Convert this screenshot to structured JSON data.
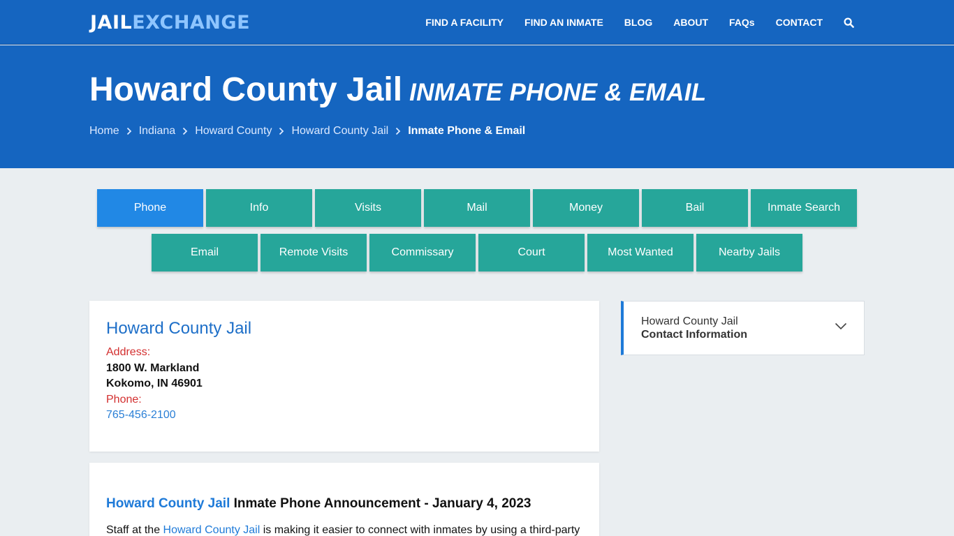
{
  "nav": {
    "logo_part1": "JAIL",
    "logo_part2": "EXCHANGE",
    "links": [
      "FIND A FACILITY",
      "FIND AN INMATE",
      "BLOG",
      "ABOUT",
      "FAQs",
      "CONTACT"
    ],
    "search_icon": "search-icon"
  },
  "hero": {
    "title": "Howard County Jail",
    "subtitle": "INMATE PHONE & EMAIL",
    "breadcrumbs": [
      "Home",
      "Indiana",
      "Howard County",
      "Howard County Jail",
      "Inmate Phone & Email"
    ]
  },
  "tabs": {
    "row1": [
      "Phone",
      "Info",
      "Visits",
      "Mail",
      "Money",
      "Bail",
      "Inmate Search"
    ],
    "row2": [
      "Email",
      "Remote Visits",
      "Commissary",
      "Court",
      "Most Wanted",
      "Nearby Jails"
    ],
    "active": "Phone"
  },
  "facility": {
    "name": "Howard County Jail",
    "address_label": "Address:",
    "address_line1": "1800 W. Markland",
    "address_line2": "Kokomo, IN 46901",
    "phone_label": "Phone:",
    "phone": "765-456-2100"
  },
  "announcement": {
    "title_link": "Howard County Jail",
    "title_rest": " Inmate Phone Announcement - January 4, 2023",
    "body_prefix": "Staff at the ",
    "body_link": "Howard County Jail",
    "body_suffix": " is making it easier to connect with inmates by using a third-party"
  },
  "sidebar": {
    "line1": "Howard County Jail",
    "line2": "Contact Information"
  },
  "colors": {
    "nav_blue": "#1565c0",
    "tab_teal": "#26a69a",
    "tab_active": "#2188e5",
    "label_red": "#d32f2f",
    "link_blue": "#1e7ad8"
  }
}
